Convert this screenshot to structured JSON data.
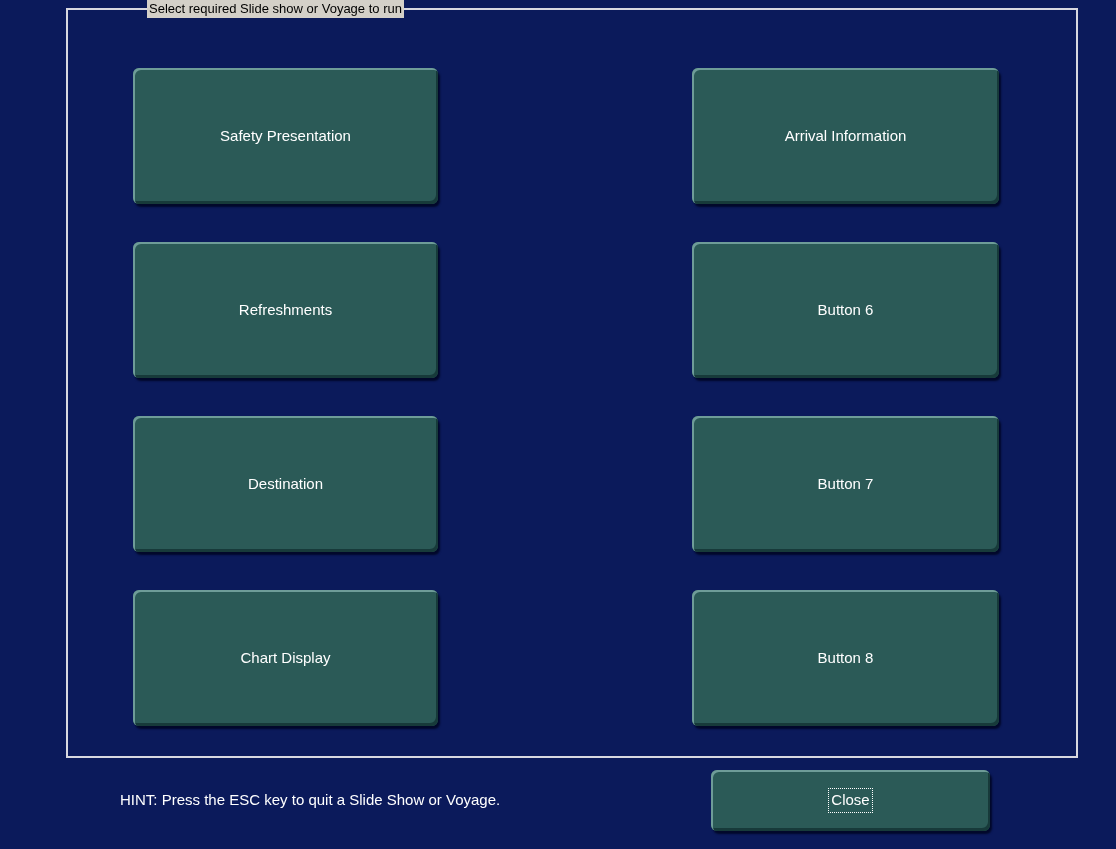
{
  "group": {
    "title": "Select required Slide show or Voyage to run"
  },
  "buttons": [
    {
      "label": "Safety Presentation"
    },
    {
      "label": "Arrival Information"
    },
    {
      "label": "Refreshments"
    },
    {
      "label": "Button 6"
    },
    {
      "label": "Destination"
    },
    {
      "label": "Button 7"
    },
    {
      "label": "Chart Display"
    },
    {
      "label": "Button 8"
    }
  ],
  "hint": "HINT: Press the ESC key to quit a Slide Show or Voyage.",
  "close_button": {
    "label": "Close",
    "focused": true
  }
}
